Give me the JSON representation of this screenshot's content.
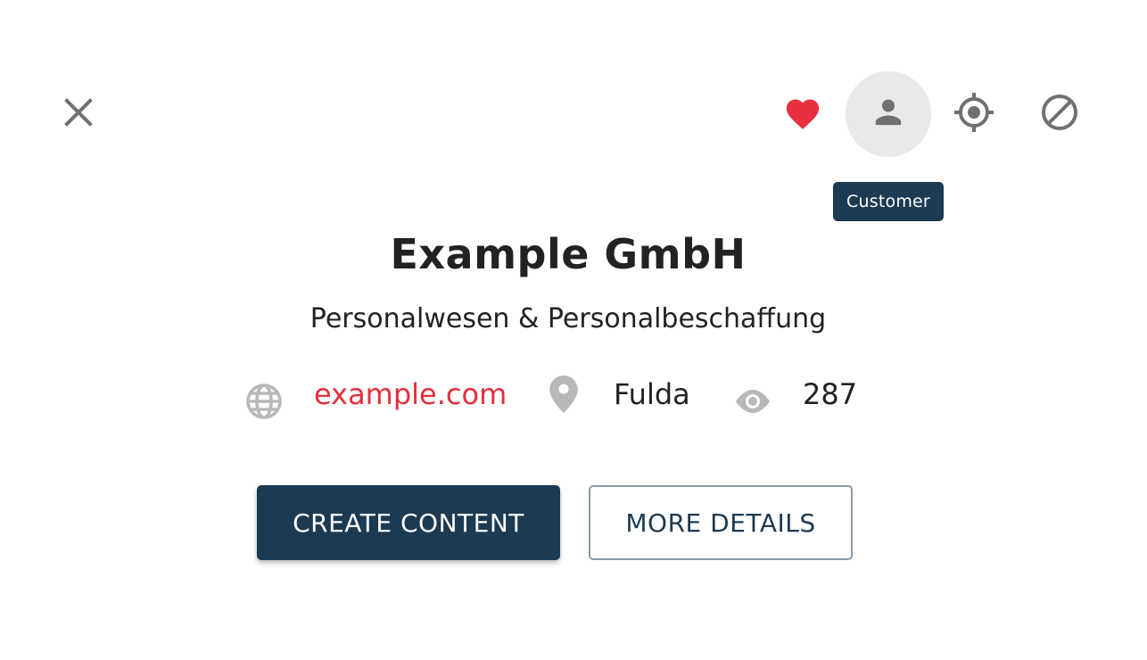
{
  "toolbar": {
    "close_icon": "close-icon",
    "favorite_icon": "heart-icon",
    "customer_icon": "person-icon",
    "target_icon": "crosshair-icon",
    "block_icon": "block-icon",
    "tooltip": "Customer"
  },
  "company": {
    "name": "Example GmbH",
    "industry": "Personalwesen & Personalbeschaffung",
    "website": "example.com",
    "city": "Fulda",
    "views": "287"
  },
  "icons": {
    "website": "globe-icon",
    "city": "location-pin-icon",
    "views": "eye-icon"
  },
  "actions": {
    "primary_label": "CREATE CONTENT",
    "secondary_label": "MORE DETAILS"
  },
  "colors": {
    "brand_navy": "#1c3a52",
    "accent_red": "#e0303c",
    "icon_gray": "#777777"
  }
}
